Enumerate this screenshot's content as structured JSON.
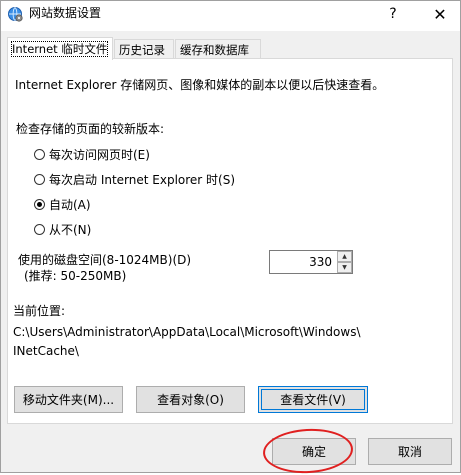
{
  "window": {
    "title": "网站数据设置",
    "help_label": "?",
    "close_label": "✕",
    "icon": "globe-settings-icon"
  },
  "tabs": [
    {
      "label": "Internet 临时文件",
      "active": true
    },
    {
      "label": "历史记录",
      "active": false
    },
    {
      "label": "缓存和数据库",
      "active": false
    }
  ],
  "panel": {
    "description": "Internet Explorer 存储网页、图像和媒体的副本以便以后快速查看。",
    "check_label": "检查存储的页面的较新版本:",
    "options": [
      {
        "label": "每次访问网页时(E)",
        "checked": false
      },
      {
        "label": "每次启动 Internet Explorer 时(S)",
        "checked": false
      },
      {
        "label": "自动(A)",
        "checked": true
      },
      {
        "label": "从不(N)",
        "checked": false
      }
    ],
    "disk_label": "使用的磁盘空间(8-1024MB)(D)",
    "disk_recommend": "(推荐: 50-250MB)",
    "disk_value": "330",
    "location_label": "当前位置:",
    "location_path_1": "C:\\Users\\Administrator\\AppData\\Local\\Microsoft\\Windows\\",
    "location_path_2": "INetCache\\",
    "buttons": {
      "move_folder": "移动文件夹(M)...",
      "view_objects": "查看对象(O)",
      "view_files": "查看文件(V)"
    }
  },
  "footer": {
    "ok": "确定",
    "cancel": "取消"
  },
  "colors": {
    "accent": "#0078d7",
    "annotation": "#e02020"
  }
}
